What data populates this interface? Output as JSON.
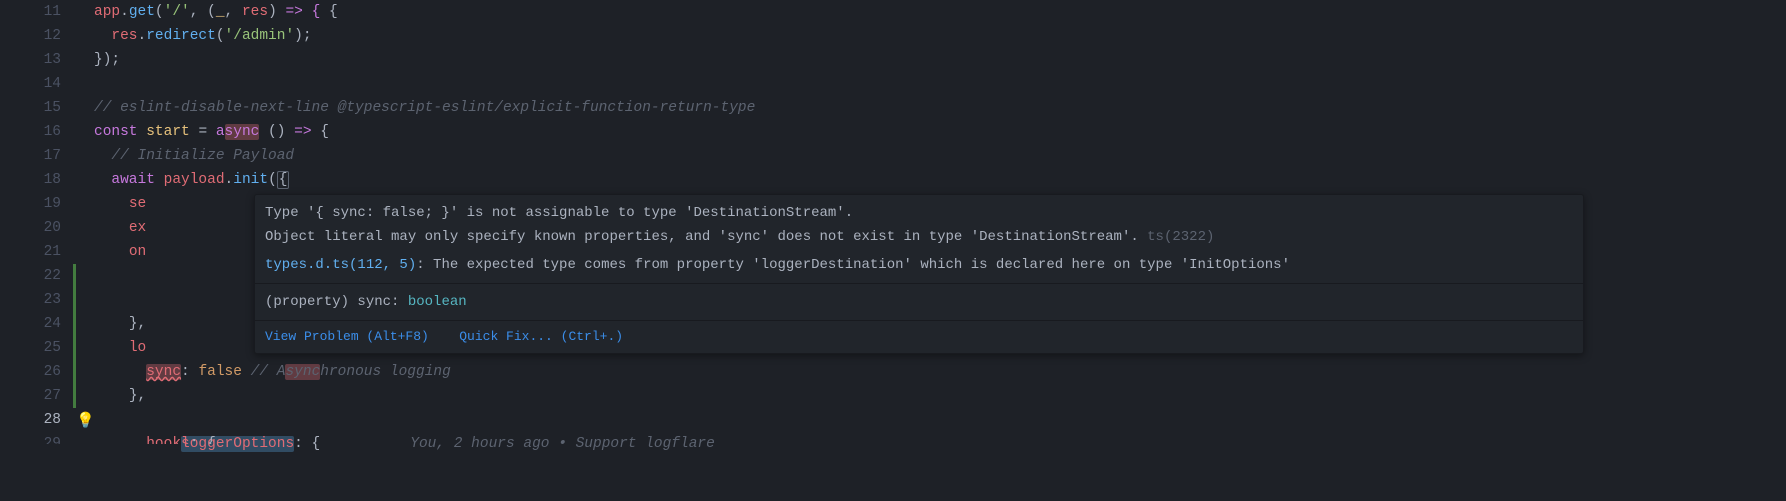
{
  "lineNumbers": [
    "11",
    "12",
    "13",
    "14",
    "15",
    "16",
    "17",
    "18",
    "19",
    "20",
    "21",
    "22",
    "23",
    "24",
    "25",
    "26",
    "27",
    "28",
    "29"
  ],
  "code": {
    "l11": {
      "app": "app",
      "get": "get",
      "path": "'/'",
      "u": "_",
      "res": "res",
      "arrow": "=> {"
    },
    "l12": {
      "res": "res",
      "redirect": "redirect",
      "path": "'/admin'"
    },
    "l13": {
      "close": "});"
    },
    "l15": {
      "comment": "// eslint-disable-next-line @typescript-eslint/explicit-function-return-type"
    },
    "l16": {
      "const": "const",
      "name": "start",
      "eq": "= ",
      "async": "async",
      "arrow": " () => {"
    },
    "l17": {
      "comment": "// Initialize Payload"
    },
    "l18": {
      "await": "await",
      "obj": "payload",
      "init": "init",
      "brace": "{"
    },
    "l19": {
      "prefix": "se"
    },
    "l20": {
      "prefix": "ex"
    },
    "l21": {
      "prefix": "on"
    },
    "l24": {
      "close": "},"
    },
    "l25": {
      "prefix": "lo"
    },
    "l26": {
      "sync": "sync",
      "val": "false",
      "comment": "// Asynchronous logging",
      "syncPart": "sync"
    },
    "l27": {
      "close": "},"
    },
    "l28": {
      "key": "loggerOptions",
      "brace": ": {",
      "lens": "You, 2 hours ago • Support logflare"
    },
    "l29": {
      "prefix": "hooks: {"
    }
  },
  "hover": {
    "err1": "Type '{ sync: false; }' is not assignable to type 'DestinationStream'.",
    "err2": "  Object literal may only specify known properties, and 'sync' does not exist in type 'DestinationStream'.",
    "tsCode": "ts(2322)",
    "relFile": "types.d.ts",
    "relLoc": "(112, 5)",
    "relMsg": ": The expected type comes from property 'loggerDestination' which is declared here on type 'InitOptions'",
    "propSig_prefix": "(property) ",
    "propSig_name": "sync",
    "propSig_colon": ": ",
    "propSig_type": "boolean",
    "viewProblem": "View Problem (Alt+F8)",
    "quickFix": "Quick Fix... (Ctrl+.)"
  }
}
